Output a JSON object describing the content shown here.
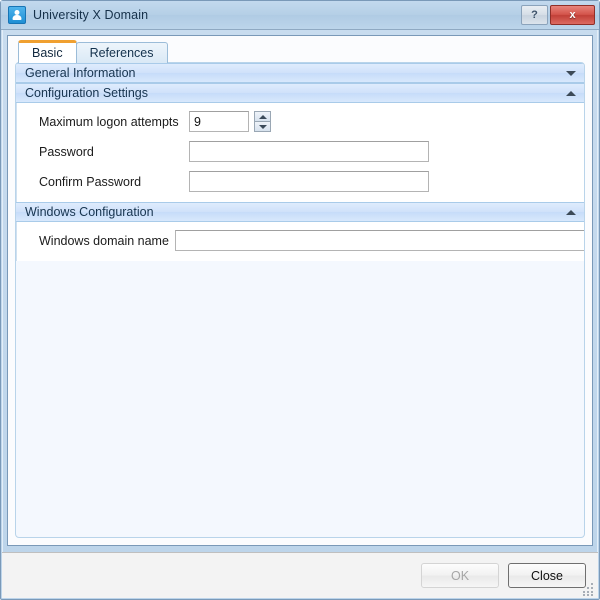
{
  "window": {
    "title": "University X Domain",
    "icon": "user-upload-icon",
    "controls": {
      "help_label": "?",
      "help_icon": "help-icon",
      "close_label": "x",
      "close_icon": "close-icon"
    },
    "colors": {
      "titlebar": "#b5cfe6",
      "frame_border": "#7a99b8",
      "close_button": "#c13f37",
      "active_tab_accent": "#f0a030",
      "panel_header": "#cfe1fa",
      "tab_body_bg": "#f4f8fe"
    }
  },
  "tabs": [
    {
      "label": "Basic",
      "active": true
    },
    {
      "label": "References",
      "active": false
    }
  ],
  "panels": [
    {
      "title": "General Information",
      "expanded": false,
      "chevron_icon": "chevron-down-icon"
    },
    {
      "title": "Configuration Settings",
      "expanded": true,
      "chevron_icon": "chevron-up-icon",
      "fields": [
        {
          "label": "Maximum logon attempts",
          "type": "number",
          "value": "9",
          "placeholder": "",
          "spinner": {
            "up_icon": "spinner-up-icon",
            "down_icon": "spinner-down-icon"
          }
        },
        {
          "label": "Password",
          "type": "password",
          "value": "",
          "placeholder": ""
        },
        {
          "label": "Confirm Password",
          "type": "password",
          "value": "",
          "placeholder": ""
        }
      ]
    },
    {
      "title": "Windows Configuration",
      "expanded": true,
      "chevron_icon": "chevron-up-icon",
      "fields": [
        {
          "label": "Windows domain name",
          "type": "text",
          "value": "",
          "placeholder": ""
        }
      ]
    }
  ],
  "footer": {
    "buttons": [
      {
        "label": "OK",
        "enabled": false
      },
      {
        "label": "Close",
        "enabled": true
      }
    ],
    "resize_grip_icon": "resize-grip-icon"
  }
}
